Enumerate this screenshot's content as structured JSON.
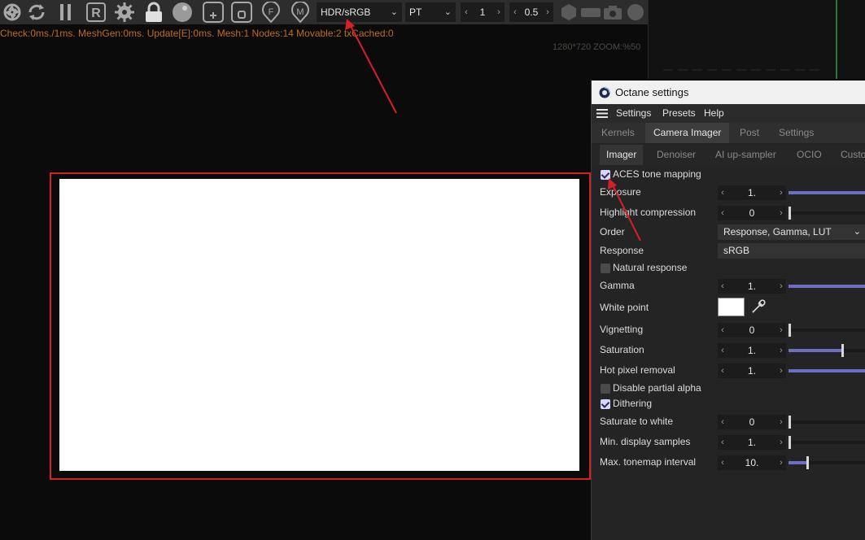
{
  "toolbar": {
    "icons": [
      "aperture-icon",
      "refresh-icon",
      "pause-icon",
      "r-letter-icon",
      "gear-icon",
      "lock-icon",
      "sphere-icon",
      "add-box-icon",
      "square-box-icon",
      "f-pin-icon",
      "m-pin-icon",
      "hexagon-icon",
      "rectangle-icon",
      "camera-icon",
      "circle-icon"
    ],
    "color_mode": "HDR/sRGB",
    "kernel": "PT",
    "spin1": "1",
    "spin2": "0.5"
  },
  "status_text": "Check:0ms./1ms. MeshGen:0ms. Update[E]:0ms. Mesh:1 Nodes:14 Movable:2 txCached:0",
  "zoom_text": "1280*720 ZOOM:%50",
  "panel": {
    "title": "Octane settings",
    "menu": [
      "Settings",
      "Presets",
      "Help"
    ],
    "tabs1": [
      "Kernels",
      "Camera Imager",
      "Post",
      "Settings"
    ],
    "tabs1_active": "Camera Imager",
    "tabs2": [
      "Imager",
      "Denoiser",
      "AI up-sampler",
      "OCIO",
      "Custo"
    ],
    "tabs2_active": "Imager",
    "aces": {
      "label": "ACES tone mapping",
      "checked": true
    },
    "exposure": {
      "label": "Exposure",
      "value": "1."
    },
    "highlight": {
      "label": "Highlight compression",
      "value": "0"
    },
    "order": {
      "label": "Order",
      "value": "Response, Gamma, LUT"
    },
    "response": {
      "label": "Response",
      "value": "sRGB"
    },
    "natural": {
      "label": "Natural response",
      "checked": false
    },
    "gamma": {
      "label": "Gamma",
      "value": "1."
    },
    "whitepoint": {
      "label": "White point",
      "color": "#ffffff"
    },
    "vignetting": {
      "label": "Vignetting",
      "value": "0"
    },
    "saturation": {
      "label": "Saturation",
      "value": "1."
    },
    "hotpixel": {
      "label": "Hot pixel removal",
      "value": "1."
    },
    "partialalpha": {
      "label": "Disable partial alpha",
      "checked": false
    },
    "dithering": {
      "label": "Dithering",
      "checked": true
    },
    "sat_white": {
      "label": "Saturate to white",
      "value": "0"
    },
    "min_samples": {
      "label": "Min. display samples",
      "value": "1."
    },
    "max_tonemap": {
      "label": "Max. tonemap interval",
      "value": "10."
    }
  },
  "colors": {
    "accent_slider": "#6e6ec8",
    "highlight_red": "#d81f26",
    "status_orange": "#c26a1f"
  }
}
